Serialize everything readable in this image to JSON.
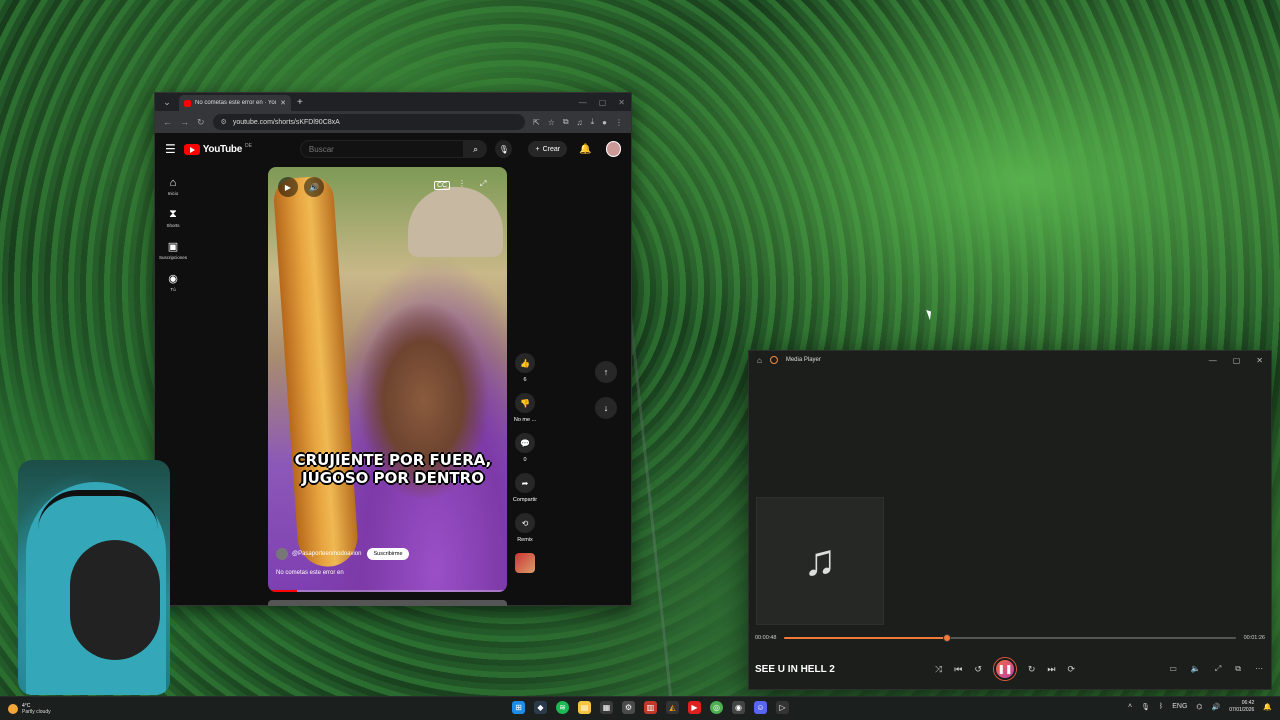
{
  "browser": {
    "tab_title": "No cometas este error en · YouTube",
    "url": "youtube.com/shorts/sKFDl90C8xA"
  },
  "youtube": {
    "logo_text": "YouTube",
    "country_code": "DE",
    "search_placeholder": "Buscar",
    "create_label": "Crear",
    "sidebar": [
      {
        "label": "Inicio",
        "icon": "home-icon"
      },
      {
        "label": "Shorts",
        "icon": "shorts-icon"
      },
      {
        "label": "Suscripciones",
        "icon": "subscriptions-icon"
      },
      {
        "label": "Tú",
        "icon": "you-icon"
      }
    ],
    "short": {
      "overlay_line1": "CRUJIENTE POR FUERA,",
      "overlay_line2": "JUGOSO POR DENTRO",
      "channel": "@Pasaporteenmodoavion",
      "subscribe_label": "Suscribirme",
      "description": "No cometas este error en",
      "progress": 0.12
    },
    "actions": {
      "likes": "6",
      "dislike_label": "No me ...",
      "comments": "0",
      "share_label": "Compartir",
      "remix_label": "Remix"
    }
  },
  "media_player": {
    "title": "Media Player",
    "song": "SEE U IN HELL 2",
    "elapsed": "00:00:48",
    "duration": "00:01:26",
    "progress": 0.36,
    "accent": "#f07a3a"
  },
  "taskbar": {
    "temperature": "4°C",
    "condition": "Partly cloudy",
    "language": "ENG",
    "time": "06:42",
    "date": "07/01/2026"
  }
}
